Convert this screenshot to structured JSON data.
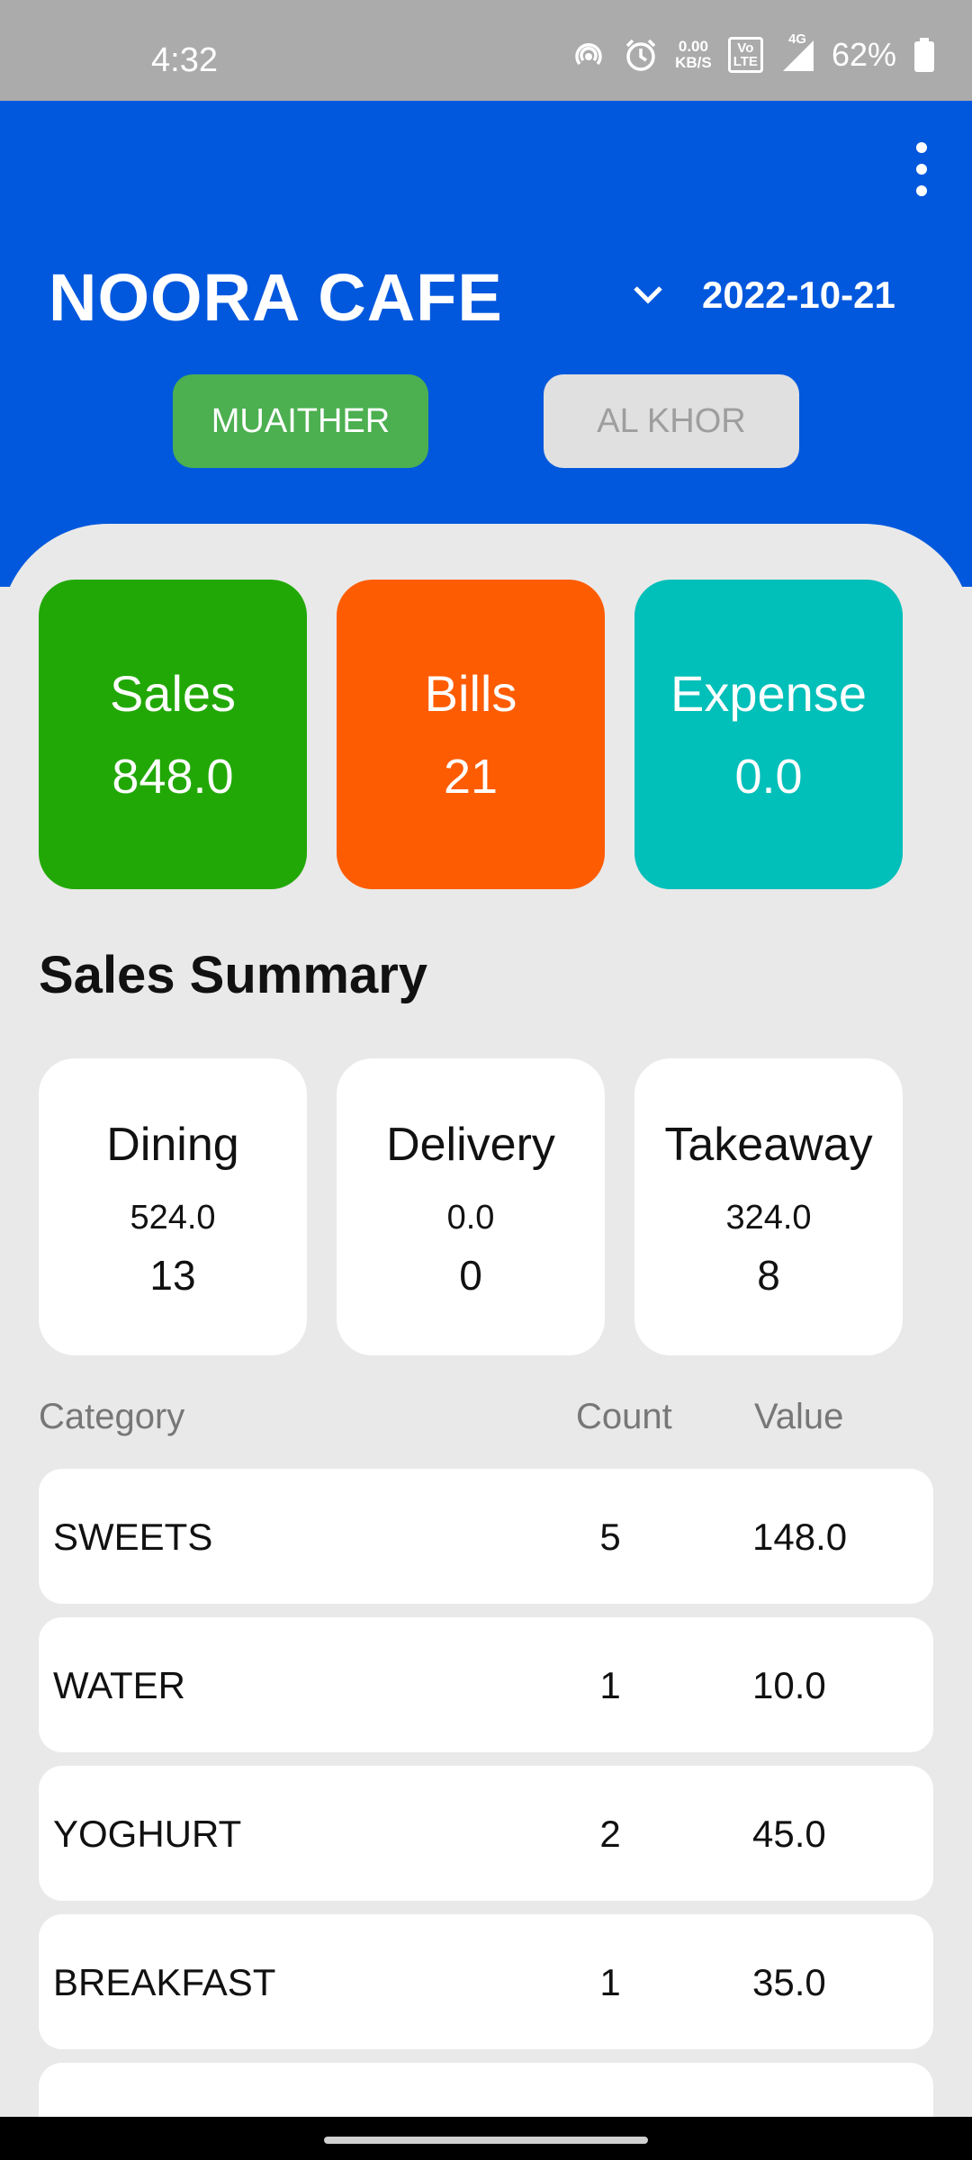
{
  "status_bar": {
    "time": "4:32",
    "net_speed_top": "0.00",
    "net_speed_bottom": "KB/S",
    "volte_top": "Vo",
    "volte_bottom": "LTE",
    "network": "4G",
    "battery": "62%",
    "icons": [
      "hotspot-icon",
      "alarm-icon",
      "signal-icon",
      "battery-icon"
    ]
  },
  "header": {
    "title": "NOORA CAFE",
    "date": "2022-10-21",
    "branches": [
      {
        "label": "MUAITHER",
        "active": true
      },
      {
        "label": "AL KHOR",
        "active": false
      }
    ],
    "colors": {
      "background": "#0258dd",
      "active_branch": "#4caf50",
      "inactive_branch": "#e0e0e0"
    }
  },
  "stats": [
    {
      "label": "Sales",
      "value": "848.0",
      "color": "#22a806"
    },
    {
      "label": "Bills",
      "value": "21",
      "color": "#fe5c02"
    },
    {
      "label": "Expense",
      "value": "0.0",
      "color": "#01bfb9"
    }
  ],
  "summary": {
    "title": "Sales Summary",
    "types": [
      {
        "label": "Dining",
        "value": "524.0",
        "count": "13"
      },
      {
        "label": "Delivery",
        "value": "0.0",
        "count": "0"
      },
      {
        "label": "Takeaway",
        "value": "324.0",
        "count": "8"
      }
    ]
  },
  "table": {
    "headers": {
      "category": "Category",
      "count": "Count",
      "value": "Value"
    },
    "rows": [
      {
        "category": "SWEETS",
        "count": "5",
        "value": "148.0"
      },
      {
        "category": "WATER",
        "count": "1",
        "value": "10.0"
      },
      {
        "category": "YOGHURT",
        "count": "2",
        "value": "45.0"
      },
      {
        "category": "BREAKFAST",
        "count": "1",
        "value": "35.0"
      }
    ]
  }
}
